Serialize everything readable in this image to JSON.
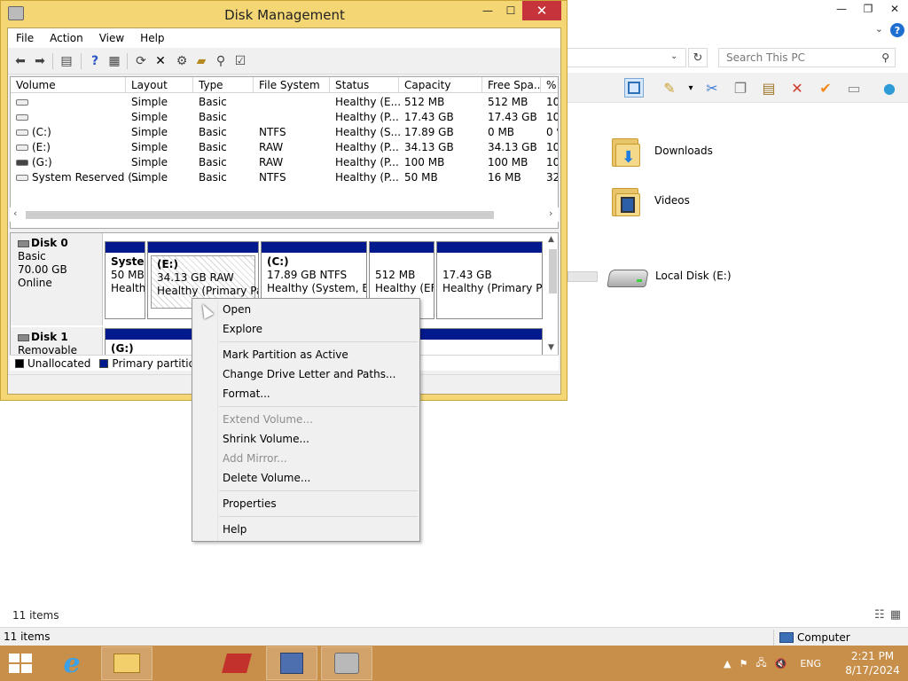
{
  "explorer": {
    "search_placeholder": "Search This PC",
    "items": [
      {
        "label": "Downloads"
      },
      {
        "label": "Videos"
      },
      {
        "label": "Local Disk (E:)"
      }
    ],
    "items_count": "11 items",
    "status_left": "11 items",
    "status_location": "Computer"
  },
  "dm": {
    "title": "Disk Management",
    "menu": [
      "File",
      "Action",
      "View",
      "Help"
    ],
    "columns": [
      "Volume",
      "Layout",
      "Type",
      "File System",
      "Status",
      "Capacity",
      "Free Spa...",
      "% F"
    ],
    "rows": [
      [
        "",
        "Simple",
        "Basic",
        "",
        "Healthy (E...",
        "512 MB",
        "512 MB",
        "100"
      ],
      [
        "",
        "Simple",
        "Basic",
        "",
        "Healthy (P...",
        "17.43 GB",
        "17.43 GB",
        "100"
      ],
      [
        "(C:)",
        "Simple",
        "Basic",
        "NTFS",
        "Healthy (S...",
        "17.89 GB",
        "0 MB",
        "0 %"
      ],
      [
        "(E:)",
        "Simple",
        "Basic",
        "RAW",
        "Healthy (P...",
        "34.13 GB",
        "34.13 GB",
        "100"
      ],
      [
        "(G:)",
        "Simple",
        "Basic",
        "RAW",
        "Healthy (P...",
        "100 MB",
        "100 MB",
        "100"
      ],
      [
        "System Reserved (...",
        "Simple",
        "Basic",
        "NTFS",
        "Healthy (P...",
        "50 MB",
        "16 MB",
        "32"
      ]
    ],
    "disk0": {
      "name": "Disk 0",
      "type": "Basic",
      "size": "70.00 GB",
      "state": "Online",
      "partitions": [
        {
          "l1": "Syster",
          "l2": "50 MB",
          "l3": "Health"
        },
        {
          "l1": "(E:)",
          "l2": "34.13 GB RAW",
          "l3": "Healthy (Primary Part"
        },
        {
          "l1": "(C:)",
          "l2": "17.89 GB NTFS",
          "l3": "Healthy (System, Bo"
        },
        {
          "l1": "",
          "l2": "512 MB",
          "l3": "Healthy (EF"
        },
        {
          "l1": "",
          "l2": "17.43 GB",
          "l3": "Healthy (Primary Pa"
        }
      ]
    },
    "disk1": {
      "name": "Disk 1",
      "type": "Removable",
      "partition_label": "(G:)"
    },
    "legend": [
      "Unallocated",
      "Primary partition"
    ],
    "colors": {
      "primary": "#031a8e",
      "unallocated": "#000000",
      "extra_legend": "#1f9a3b"
    }
  },
  "context_menu": {
    "items": [
      {
        "label": "Open",
        "enabled": true
      },
      {
        "label": "Explore",
        "enabled": true
      },
      {
        "label": "Mark Partition as Active",
        "enabled": true
      },
      {
        "label": "Change Drive Letter and Paths...",
        "enabled": true
      },
      {
        "label": "Format...",
        "enabled": true
      },
      {
        "label": "Extend Volume...",
        "enabled": false
      },
      {
        "label": "Shrink Volume...",
        "enabled": true
      },
      {
        "label": "Add Mirror...",
        "enabled": false
      },
      {
        "label": "Delete Volume...",
        "enabled": true
      },
      {
        "label": "Properties",
        "enabled": true
      },
      {
        "label": "Help",
        "enabled": true
      }
    ]
  },
  "taskbar": {
    "tray_language": "ENG",
    "time": "2:21 PM",
    "date": "8/17/2024",
    "accent": "#c88f4a"
  }
}
